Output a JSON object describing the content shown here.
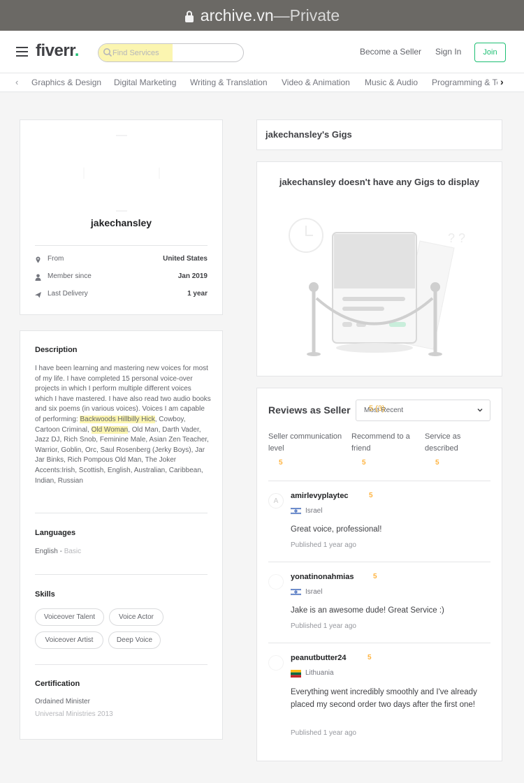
{
  "browser": {
    "domain": "archive.vn",
    "separator": " — ",
    "mode": "Private"
  },
  "header": {
    "logo": "fiverr",
    "logo_dot": ".",
    "search_placeholder": "Find Services",
    "become_seller": "Become a Seller",
    "sign_in": "Sign In",
    "join": "Join"
  },
  "categories": [
    "Graphics & Design",
    "Digital Marketing",
    "Writing & Translation",
    "Video & Animation",
    "Music & Audio",
    "Programming & Tech"
  ],
  "profile": {
    "username": "jakechansley",
    "info": [
      {
        "icon": "location-pin-icon",
        "label": "From",
        "value": "United States"
      },
      {
        "icon": "user-icon",
        "label": "Member since",
        "value": "Jan 2019"
      },
      {
        "icon": "paper-plane-icon",
        "label": "Last Delivery",
        "value": "1 year"
      }
    ]
  },
  "about": {
    "description_title": "Description",
    "description_pre": "I have been learning and mastering new voices for most of my life. I have completed 15 personal voice-over projects in which I perform multiple different voices which I have mastered. I have also read two audio books and six poems (in various voices). Voices I am capable of performing: ",
    "description_hl1": "Backwoods Hillbilly Hick",
    "description_mid1": ", Cowboy, Cartoon Criminal, ",
    "description_hl2": "Old Woman",
    "description_post": ", Old Man, Darth Vader, Jazz DJ, Rich Snob, Feminine Male, Asian Zen Teacher, Warrior, Goblin, Orc, Saul Rosenberg (Jerky Boys), Jar Jar Binks, Rich Pompous Old Man, The Joker Accents:Irish, Scottish, English, Australian, Caribbean, Indian, Russian",
    "languages_title": "Languages",
    "language": "English",
    "language_sep": " - ",
    "language_level": "Basic",
    "skills_title": "Skills",
    "skills": [
      "Voiceover Talent",
      "Voice Actor",
      "Voiceover Artist",
      "Deep Voice"
    ],
    "certification_title": "Certification",
    "cert_name": "Ordained Minister",
    "cert_org": "Universal Ministries 2013"
  },
  "gigs": {
    "title": "jakechansley's Gigs",
    "empty_message": "jakechansley doesn't have any Gigs to display"
  },
  "reviews": {
    "title": "Reviews as Seller",
    "sort_value": "Most Recent",
    "sort_overlay": "5 (3)",
    "metrics": [
      {
        "label": "Seller communication level",
        "score": "5"
      },
      {
        "label": "Recommend to a friend",
        "score": "5"
      },
      {
        "label": "Service as described",
        "score": "5"
      }
    ],
    "items": [
      {
        "avatar": "A",
        "user": "amirlevyplaytec",
        "stars": "5",
        "country": "Israel",
        "text": "Great voice, professional!",
        "date": "Published 1 year ago"
      },
      {
        "avatar": "",
        "user": "yonatinonahmias",
        "stars": "5",
        "country": "Israel",
        "text": "Jake is an awesome dude! Great Service :)",
        "date": "Published 1 year ago"
      },
      {
        "avatar": "",
        "user": "peanutbutter24",
        "stars": "5",
        "country": "Lithuania",
        "text": "Everything went incredibly smoothly and I've already placed my second order two days after the first one!",
        "date": "Published 1 year ago"
      }
    ]
  },
  "colors": {
    "brand_green": "#1dbf73",
    "star_yellow": "#ffb33e",
    "highlight": "#fbf5b0"
  }
}
